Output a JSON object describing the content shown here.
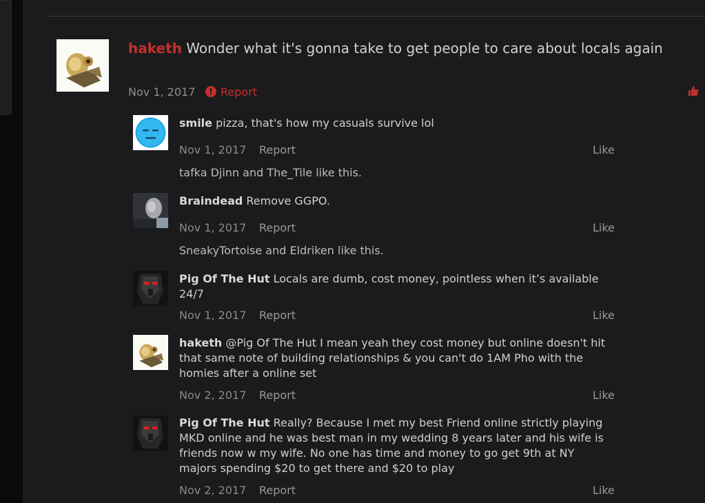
{
  "post": {
    "username": "haketh",
    "message": "Wonder what it's gonna take to get people to care about locals again",
    "date": "Nov 1, 2017",
    "report_label": "Report",
    "avatar_icon": "robot-avatar-icon",
    "like_icon": "thumbs-up-icon",
    "accent_color": "#c4302b"
  },
  "comments": [
    {
      "username": "smile",
      "message": "pizza, that's how my casuals survive lol",
      "date": "Nov 1, 2017",
      "report_label": "Report",
      "like_label": "Like",
      "likes_text": "tafka Djinn and The_Tile like this."
    },
    {
      "username": "Braindead",
      "message": "Remove GGPO.",
      "date": "Nov 1, 2017",
      "report_label": "Report",
      "like_label": "Like",
      "likes_text": "SneakyTortoise and Eldriken like this."
    },
    {
      "username": "Pig Of The Hut",
      "message": "Locals are dumb, cost money, pointless when it’s available 24/7",
      "date": "Nov 1, 2017",
      "report_label": "Report",
      "like_label": "Like"
    },
    {
      "username": "haketh",
      "message": "@Pig Of The Hut I mean yeah they cost money but online doesn't hit that same note of building relationships & you can't do 1AM Pho with the homies after a online set",
      "date": "Nov 2, 2017",
      "report_label": "Report",
      "like_label": "Like"
    },
    {
      "username": "Pig Of The Hut",
      "message": "Really? Because I met my best Friend online strictly playing MKD online and he was best man in my wedding 8 years later and his wife is friends now w my wife. No one has time and money to go get 9th at NY majors spending $20 to get there and $20 to play",
      "date": "Nov 2, 2017",
      "report_label": "Report",
      "like_label": "Like"
    }
  ]
}
